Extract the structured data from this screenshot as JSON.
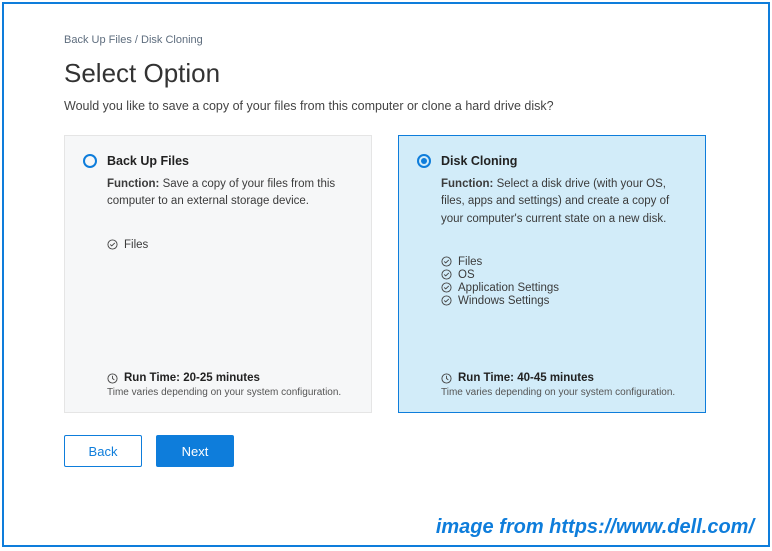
{
  "breadcrumb": "Back Up Files / Disk Cloning",
  "title": "Select Option",
  "subtitle": "Would you like to save a copy of your files from this computer or clone a hard drive disk?",
  "cards": {
    "backup": {
      "title": "Back Up Files",
      "fn_label": "Function:",
      "fn_text": " Save a copy of your files from this computer to an external storage device.",
      "items": [
        "Files"
      ],
      "runtime_label": "Run Time: 20-25 minutes",
      "runtime_note": "Time varies depending on your system configuration.",
      "selected": false
    },
    "cloning": {
      "title": "Disk Cloning",
      "fn_label": "Function:",
      "fn_text": " Select a disk drive (with your OS, files, apps and settings) and create a copy of your computer's current state on a new disk.",
      "items": [
        "Files",
        "OS",
        "Application Settings",
        "Windows Settings"
      ],
      "runtime_label": "Run Time: 40-45 minutes",
      "runtime_note": "Time varies depending on your system configuration.",
      "selected": true
    }
  },
  "buttons": {
    "back": "Back",
    "next": "Next"
  },
  "watermark": "image from https://www.dell.com/"
}
